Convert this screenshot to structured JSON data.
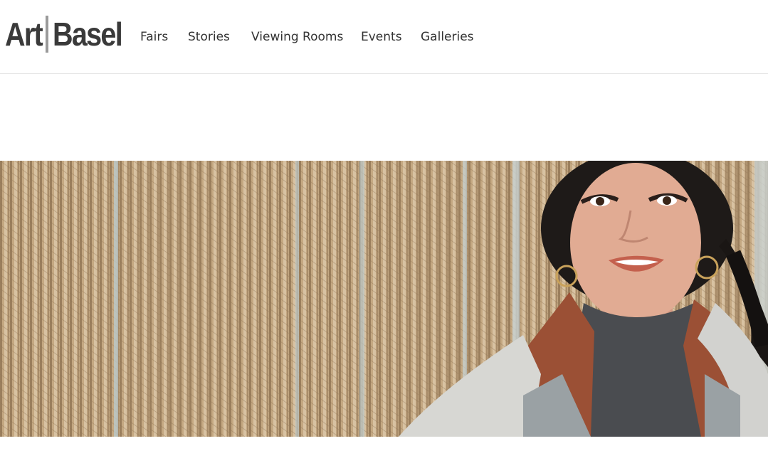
{
  "brand": {
    "logo_text_left": "Art",
    "logo_text_right": "Basel"
  },
  "nav": {
    "items": [
      "Fairs",
      "Stories",
      "Viewing Rooms",
      "Events",
      "Galleries"
    ]
  },
  "hero": {
    "image_alt": ""
  }
}
